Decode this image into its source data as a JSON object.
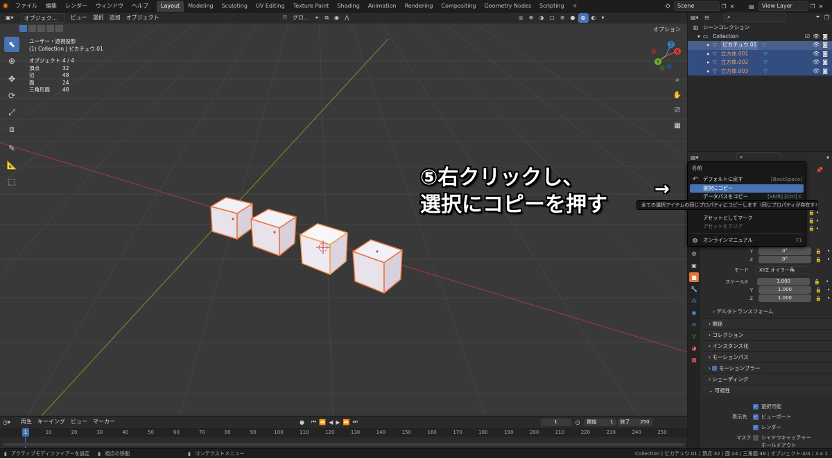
{
  "topbar": {
    "menus": [
      "ファイル",
      "編集",
      "レンダー",
      "ウィンドウ",
      "ヘルプ"
    ],
    "workspaces": [
      "Layout",
      "Modeling",
      "Sculpting",
      "UV Editing",
      "Texture Paint",
      "Shading",
      "Animation",
      "Rendering",
      "Compositing",
      "Geometry Nodes",
      "Scripting"
    ],
    "active_workspace": "Layout",
    "add_tab": "+",
    "scene": "Scene",
    "view_layer": "View Layer"
  },
  "viewport": {
    "mode": "オブジェク...",
    "menus": [
      "ビュー",
      "選択",
      "追加",
      "オブジェクト"
    ],
    "orientation": "グロ...",
    "options": "オプション",
    "view_name": "ユーザー・透視投影",
    "context": "(1) Collection | ピカチュウ.01",
    "stats": [
      {
        "label": "オブジェクト",
        "value": "4 / 4"
      },
      {
        "label": "頂点",
        "value": "32"
      },
      {
        "label": "辺",
        "value": "48"
      },
      {
        "label": "面",
        "value": "24"
      },
      {
        "label": "三角形面",
        "value": "48"
      }
    ],
    "gizmo": {
      "x": "X",
      "y": "Y",
      "z": "Z"
    }
  },
  "outliner": {
    "search_placeholder": "",
    "root": "シーンコレクション",
    "collection": "Collection",
    "objects": [
      {
        "name": "ピカチュウ.01",
        "active": true
      },
      {
        "name": "立方体.001",
        "active": false
      },
      {
        "name": "立方体.002",
        "active": false
      },
      {
        "name": "立方体.003",
        "active": false
      }
    ]
  },
  "context_menu": {
    "title": "名前",
    "items": [
      {
        "label": "デフォルトに戻す",
        "shortcut": "[BackSpace]",
        "icon": "↶",
        "state": "normal"
      },
      {
        "label": "選択にコピー",
        "shortcut": "",
        "icon": "",
        "state": "highlighted"
      },
      {
        "label": "データパスをコピー",
        "shortcut": "[Shift] [Ctrl] C",
        "icon": "",
        "state": "partial"
      },
      {
        "label": "アセットとしてマーク",
        "shortcut": "",
        "icon": "",
        "state": "normal"
      },
      {
        "label": "アセットをクリア",
        "shortcut": "",
        "icon": "",
        "state": "dim"
      },
      {
        "label": "オンラインマニュアル",
        "shortcut": "F1",
        "icon": "◍",
        "state": "normal"
      }
    ],
    "tooltip": "全ての選択アイテムの同じプロパティにコピーします（同じプロパティが存在する場合）"
  },
  "annotation": {
    "line1": "⑤右クリックし、",
    "line2": "選択にコピーを押す",
    "arrow": "→"
  },
  "properties": {
    "rotation": [
      {
        "axis": "Y",
        "value": "0°"
      },
      {
        "axis": "Z",
        "value": "0°"
      }
    ],
    "mode_label": "モード",
    "mode_value": "XYZ オイラー角",
    "scale_label": "スケール",
    "scale": [
      {
        "axis": "X",
        "value": "1.000"
      },
      {
        "axis": "Y",
        "value": "1.000"
      },
      {
        "axis": "Z",
        "value": "1.000"
      }
    ],
    "delta": "デルタトランスフォーム",
    "sections": [
      "関係",
      "コレクション",
      "インスタンス化",
      "モーションパス",
      "モーションブラー",
      "シェーディング"
    ],
    "visibility": {
      "title": "可視性",
      "selectable": "選択可能",
      "show_in_label": "表示先",
      "viewport": "ビューポート",
      "render": "レンダー",
      "mask_label": "マスク",
      "shadow_catcher": "シャドウキャッチャー",
      "holdout": "ホールドアウト"
    }
  },
  "timeline": {
    "menus": [
      "再生",
      "キーイング",
      "ビュー",
      "マーカー"
    ],
    "current_frame": "1",
    "start_label": "開始",
    "start": "1",
    "end_label": "終了",
    "end": "250",
    "ticks": [
      "1",
      "10",
      "20",
      "30",
      "40",
      "50",
      "60",
      "70",
      "80",
      "90",
      "100",
      "110",
      "120",
      "130",
      "140",
      "150",
      "160",
      "170",
      "180",
      "190",
      "200",
      "210",
      "220",
      "230",
      "240",
      "250"
    ]
  },
  "statusbar": {
    "left1": "アクティブモディファイアーを設定",
    "left2": "視点の移動",
    "left3": "コンテクストメニュー",
    "right": "Collection | ピカチュウ.01 | 頂点:32 | 面:24 | 三角面:48 | オブジェクト:4/4 | 3.4.1"
  }
}
